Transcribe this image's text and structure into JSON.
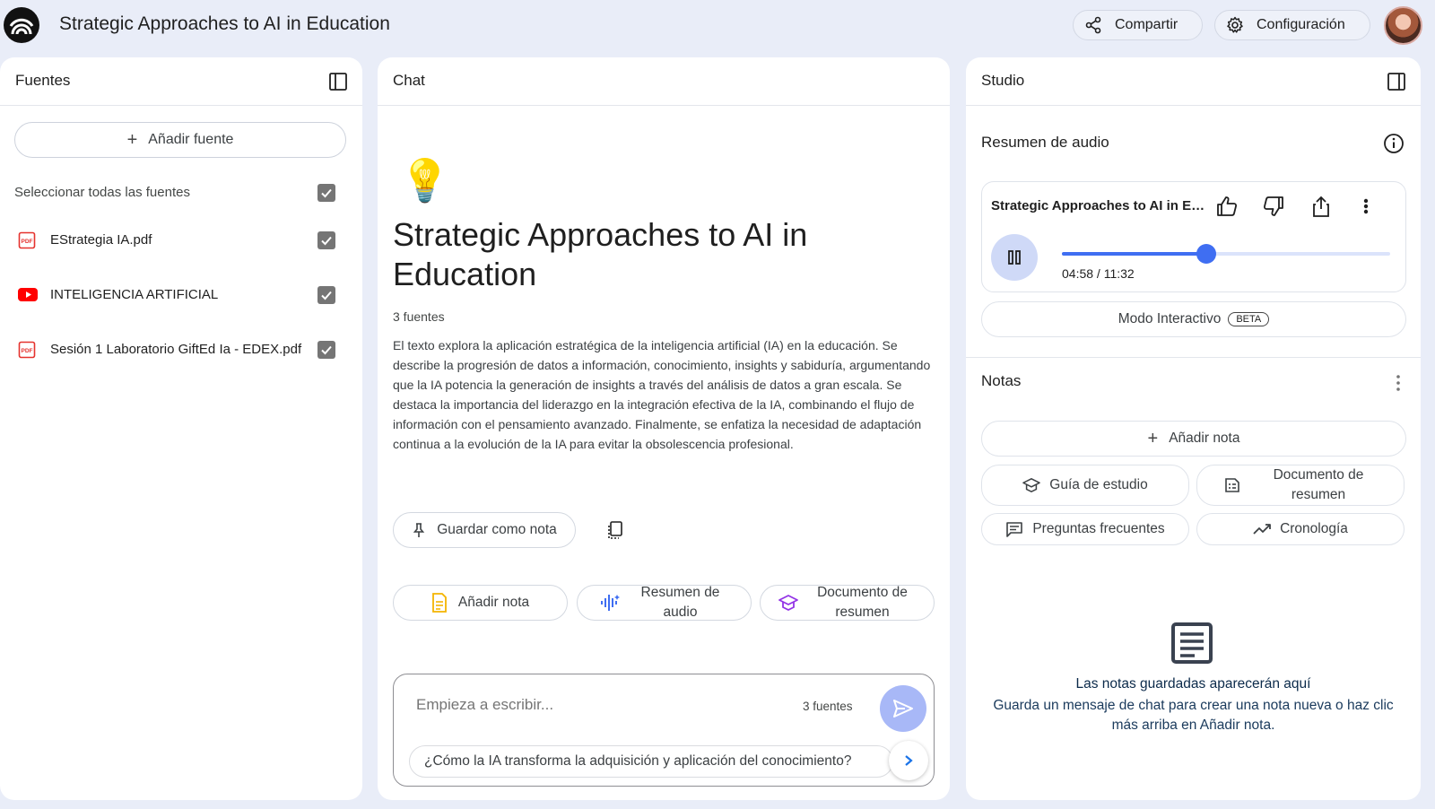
{
  "header": {
    "title": "Strategic Approaches to AI in Education",
    "share_label": "Compartir",
    "settings_label": "Configuración"
  },
  "sources_panel": {
    "title": "Fuentes",
    "add_source_label": "Añadir fuente",
    "select_all_label": "Seleccionar todas las fuentes",
    "items": [
      {
        "name": "EStrategia IA.pdf",
        "type": "pdf-icon"
      },
      {
        "name": "INTELIGENCIA ARTIFICIAL",
        "type": "youtube-icon"
      },
      {
        "name": "Sesión 1 Laboratorio GiftEd Ia - EDEX.pdf",
        "type": "pdf-icon"
      }
    ]
  },
  "chat_panel": {
    "title": "Chat",
    "notebook_title": "Strategic Approaches to AI in Education",
    "source_count": "3 fuentes",
    "summary": "El texto explora la aplicación estratégica de la inteligencia artificial (IA) en la educación. Se describe la progresión de datos a información, conocimiento, insights y sabiduría, argumentando que la IA potencia la generación de insights a través del análisis de datos a gran escala. Se destaca la importancia del liderazgo en la integración efectiva de la IA, combinando el flujo de información con el pensamiento avanzado. Finalmente, se enfatiza la necesidad de adaptación continua a la evolución de la IA para evitar la obsolescencia profesional.",
    "save_note_label": "Guardar como nota",
    "actions": [
      {
        "label": "Añadir nota"
      },
      {
        "label": "Resumen de audio"
      },
      {
        "label": "Documento de resumen"
      }
    ],
    "composer": {
      "placeholder": "Empieza a escribir...",
      "source_count": "3 fuentes",
      "suggestion": "¿Cómo la IA transforma la adquisición y aplicación del conocimiento?"
    }
  },
  "studio_panel": {
    "title": "Studio",
    "audio_section_title": "Resumen de audio",
    "audio": {
      "title": "Strategic Approaches to AI in Education",
      "time": "04:58 / 11:32",
      "progress": 0.4387
    },
    "interactive_label": "Modo Interactivo",
    "beta_label": "BETA",
    "notes_title": "Notas",
    "add_note_label": "Añadir nota",
    "note_types": [
      {
        "label": "Guía de estudio",
        "icon": "graduation-cap-icon"
      },
      {
        "label": "Documento de resumen",
        "icon": "document-list-icon"
      },
      {
        "label": "Preguntas frecuentes",
        "icon": "chat-lines-icon"
      },
      {
        "label": "Cronología",
        "icon": "trend-icon"
      }
    ],
    "empty_title": "Las notas guardadas aparecerán aquí",
    "empty_desc": "Guarda un mensaje de chat para crear una nota nueva o haz clic más arriba en Añadir nota."
  },
  "colors": {
    "background": "#e9edf8",
    "accent": "#3f6ef2",
    "send_button": "#a8b8f7",
    "pdf_red": "#e5322d",
    "youtube_red": "#ff0000"
  }
}
